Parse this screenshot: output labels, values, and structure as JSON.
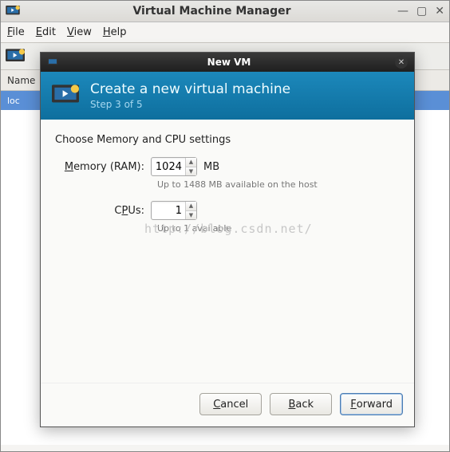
{
  "main_window": {
    "title": "Virtual Machine Manager",
    "menu": {
      "file": "File",
      "edit": "Edit",
      "view": "View",
      "help": "Help"
    },
    "column_header": "Name",
    "selected_row": "loc"
  },
  "dialog": {
    "titlebar": "New VM",
    "header_title": "Create a new virtual machine",
    "step_label": "Step 3 of 5",
    "section_label": "Choose Memory and CPU settings",
    "memory": {
      "label": "Memory (RAM):",
      "value": "1024",
      "unit": "MB",
      "hint": "Up to 1488 MB available on the host"
    },
    "cpus": {
      "label": "CPUs:",
      "value": "1",
      "hint": "Up to 1 available"
    },
    "buttons": {
      "cancel": "Cancel",
      "back": "Back",
      "forward": "Forward"
    }
  },
  "watermark": "http://blog.csdn.net/"
}
